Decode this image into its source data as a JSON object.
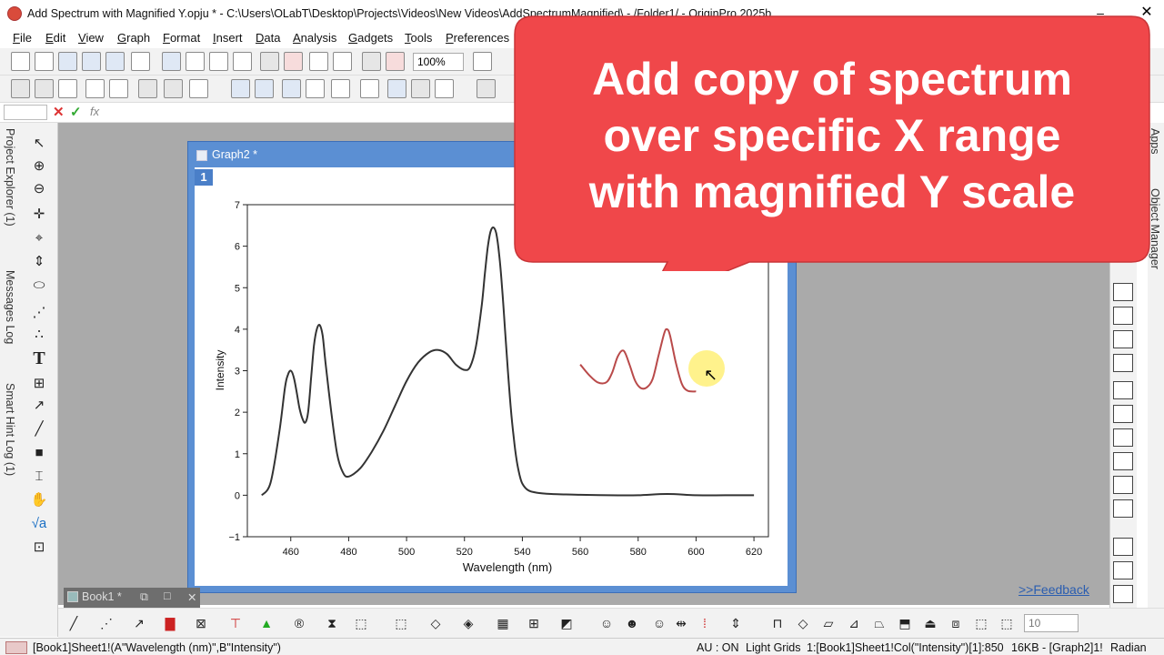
{
  "window": {
    "title": "Add Spectrum with Magnified Y.opju * - C:\\Users\\OLabT\\Desktop\\Projects\\Videos\\New Videos\\AddSpectrumMagnified\\ - /Folder1/ - OriginPro 2025b",
    "minimize_label": "–",
    "close_label": "✕"
  },
  "menu": [
    "File",
    "Edit",
    "View",
    "Graph",
    "Format",
    "Insert",
    "Data",
    "Analysis",
    "Gadgets",
    "Tools",
    "Preferences"
  ],
  "toolbar": {
    "zoom_value": "100%"
  },
  "formula_bar": {
    "cancel": "✕",
    "accept": "✓",
    "fx": "fx"
  },
  "left_dock": {
    "tabs": [
      "Project Explorer (1)",
      "Messages Log",
      "Smart Hint Log (1)"
    ]
  },
  "right_dock": {
    "tabs": [
      "Apps",
      "Object Manager"
    ]
  },
  "graph_window": {
    "title": "Graph2 *",
    "layer": "1"
  },
  "book_tab": {
    "label": "Book1 *",
    "restore": "⧉",
    "maximize": "□",
    "close": "✕"
  },
  "feedback_link": ">>Feedback",
  "font_size_value": "10",
  "callout": {
    "lines": [
      "Add copy of spectrum",
      "over specific X range",
      "with magnified Y scale"
    ],
    "color": "#f0474a"
  },
  "status": {
    "left": "[Book1]Sheet1!(A\"Wavelength (nm)\",B\"Intensity\")",
    "au": "AU : ON",
    "grids": "Light Grids",
    "col": "1:[Book1]Sheet1!Col(\"Intensity\")[1]:850",
    "mem": "16KB - [Graph2]1!",
    "angle": "Radian"
  },
  "chart_data": {
    "type": "line",
    "xlabel": "Wavelength (nm)",
    "ylabel": "Intensity",
    "xlim": [
      445,
      625
    ],
    "ylim": [
      -1,
      7
    ],
    "xticks": [
      460,
      480,
      500,
      520,
      540,
      560,
      580,
      600,
      620
    ],
    "yticks": [
      -1,
      0,
      1,
      2,
      3,
      4,
      5,
      6,
      7
    ],
    "series": [
      {
        "color": "#333333",
        "x": [
          450,
          453,
          456,
          458,
          459,
          460,
          461,
          462,
          463,
          464,
          465,
          466,
          467,
          468,
          469,
          470,
          471,
          472,
          474,
          476,
          478,
          480,
          484,
          488,
          492,
          496,
          500,
          504,
          508,
          511,
          514,
          517,
          520,
          522,
          524,
          526,
          527,
          528,
          529,
          530,
          531,
          532,
          533,
          534,
          535,
          536,
          537,
          538,
          539,
          540,
          542,
          545,
          550,
          555,
          560,
          570,
          580,
          590,
          600,
          610,
          620
        ],
        "y": [
          0.0,
          0.3,
          1.5,
          2.6,
          2.9,
          3.0,
          2.85,
          2.5,
          2.1,
          1.85,
          1.75,
          2.0,
          2.8,
          3.6,
          4.0,
          4.1,
          3.85,
          3.2,
          2.0,
          1.0,
          0.55,
          0.45,
          0.65,
          1.05,
          1.55,
          2.15,
          2.75,
          3.2,
          3.45,
          3.5,
          3.4,
          3.15,
          3.02,
          3.1,
          3.6,
          4.6,
          5.3,
          5.95,
          6.35,
          6.45,
          6.3,
          5.8,
          5.0,
          4.0,
          3.0,
          2.1,
          1.4,
          0.85,
          0.5,
          0.28,
          0.12,
          0.06,
          0.03,
          0.02,
          0.01,
          0.0,
          0.0,
          0.03,
          0.0,
          0.0,
          0.0
        ]
      },
      {
        "color": "#b94a4a",
        "x": [
          560,
          563,
          566,
          569,
          571,
          573,
          575,
          577,
          579,
          581,
          583,
          585,
          587,
          589,
          590,
          591,
          593,
          595,
          597,
          600
        ],
        "y": [
          3.15,
          2.9,
          2.72,
          2.72,
          2.95,
          3.35,
          3.48,
          3.15,
          2.75,
          2.58,
          2.6,
          2.8,
          3.35,
          3.9,
          4.0,
          3.85,
          3.2,
          2.7,
          2.52,
          2.5
        ]
      }
    ]
  }
}
